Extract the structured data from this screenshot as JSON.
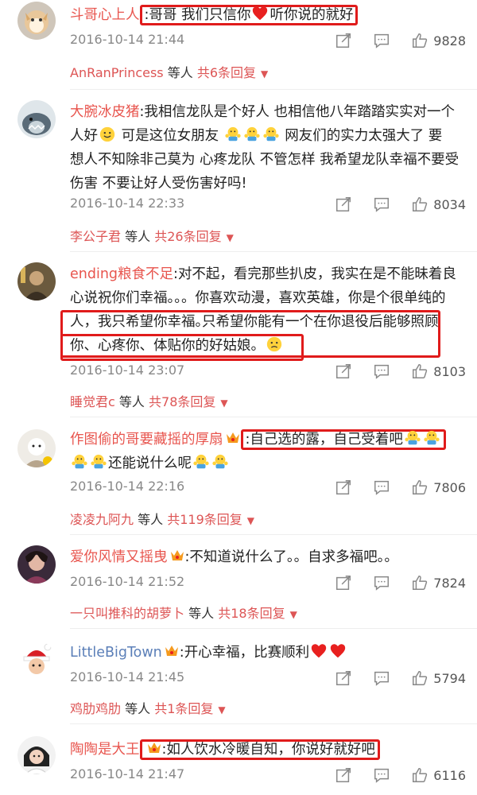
{
  "colors": {
    "username": "#e8554e",
    "username_alt": "#5b7fb8",
    "highlight": "#e01b1b",
    "meta": "#888888"
  },
  "comments": [
    {
      "user": "斗哥心上人",
      "sep": ":",
      "text_a": "哥哥 我们只信你",
      "text_b": "听你说的就好",
      "time": "2016-10-14 21:44",
      "likes": "9828",
      "reply_user": "AnRanPrincess",
      "reply_and": "等人",
      "reply_count": "共6条回复"
    },
    {
      "user": "大腕冰皮猪",
      "sep": ":",
      "line1": "我相信龙队是个好人 也相信他八年踏踏实实对一个",
      "line2a": "人好",
      "line2b": "可是这位女朋友",
      "line2c": "网友们的实力太强大了 要",
      "line3": "想人不知除非己莫为 心疼龙队 不管怎样 我希望龙队幸福不要受",
      "line4": "伤害 不要让好人受伤害好吗!",
      "time": "2016-10-14 22:33",
      "likes": "8034",
      "reply_user": "李公子君",
      "reply_and": "等人",
      "reply_count": "共26条回复"
    },
    {
      "user": "ending粮食不足",
      "sep": ":",
      "line1": "对不起，看完那些扒皮，我实在是不能昧着良",
      "line2": "心说祝你们幸福。。。你喜欢动漫，喜欢英雄，你是个很单纯的",
      "line3a": "人，我只希望你幸福。",
      "line3b": "只希望你能有一个在你退役后能够照顾",
      "line4": "你、心疼你、体贴你的好姑娘。",
      "time": "2016-10-14 23:07",
      "likes": "8103",
      "reply_user": "睡觉君c",
      "reply_and": "等人",
      "reply_count": "共78条回复"
    },
    {
      "user": "作图偷的哥要藏摇的厚扇",
      "sep": ":",
      "text": "自己选的露，自己受着吧",
      "line2": "还能说什么呢",
      "time": "2016-10-14 22:16",
      "likes": "7806",
      "reply_user": "凌凌九阿九",
      "reply_and": "等人",
      "reply_count": "共119条回复"
    },
    {
      "user": "爱你风情又摇曳",
      "sep": ":",
      "text": "不知道说什么了。。自求多福吧。。",
      "time": "2016-10-14 21:52",
      "likes": "7824",
      "reply_user": "一只叫推科的胡萝卜",
      "reply_and": "等人",
      "reply_count": "共18条回复"
    },
    {
      "user": "LittleBigTown",
      "sep": ":",
      "text": "开心幸福，比赛顺利",
      "time": "2016-10-14 21:45",
      "likes": "5794",
      "reply_user": "鸡肋鸡肋",
      "reply_and": "等人",
      "reply_count": "共1条回复"
    },
    {
      "user": "陶陶是大王",
      "sep": ":",
      "text": "如人饮水冷暖自知，你说好就好吧",
      "time": "2016-10-14 21:47",
      "likes": "6116"
    }
  ]
}
